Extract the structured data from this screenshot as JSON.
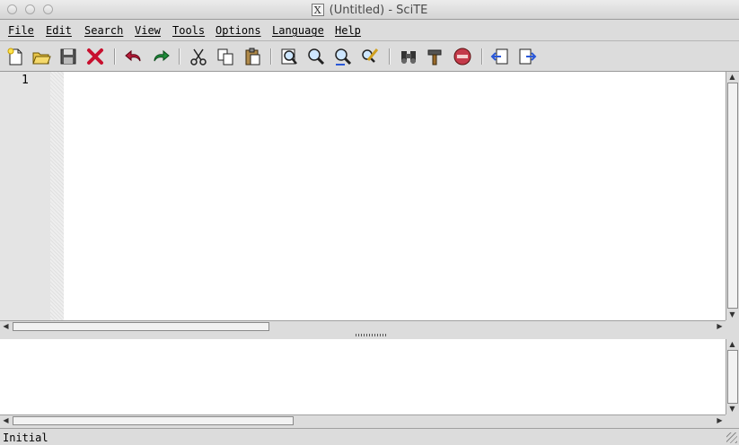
{
  "window": {
    "title": "(Untitled) - SciTE",
    "x_glyph": "X"
  },
  "menu": {
    "items": [
      "File",
      "Edit",
      "Search",
      "View",
      "Tools",
      "Options",
      "Language",
      "Help"
    ]
  },
  "toolbar": {
    "buttons": [
      "new-file",
      "open-file",
      "save-file",
      "close-file",
      "undo",
      "redo",
      "cut",
      "copy",
      "paste",
      "find",
      "find-in-files",
      "find-next",
      "replace",
      "compile",
      "build",
      "stop-execution",
      "previous-tab",
      "next-tab"
    ]
  },
  "editor": {
    "line_numbers": [
      "1"
    ],
    "content": ""
  },
  "status": {
    "text": "Initial"
  }
}
